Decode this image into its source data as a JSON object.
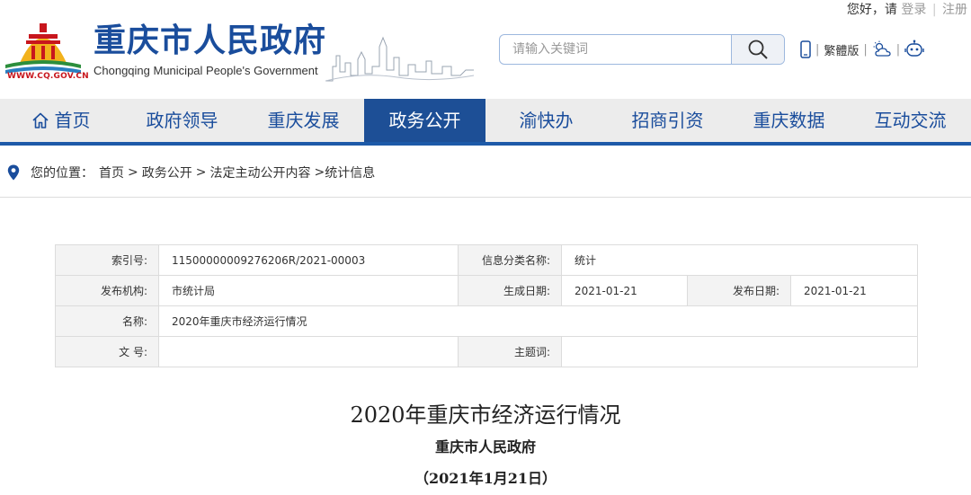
{
  "header": {
    "logo_url_text": "WWW.CQ.GOV.CN",
    "site_title": "重庆市人民政府",
    "site_subtitle": "Chongqing Municipal People's Government",
    "greeting": "您好，请",
    "login_label": "登录",
    "divider": "|",
    "register_label": "注册",
    "search_placeholder": "请输入关键词",
    "traditional_label": "繁體版",
    "icons": [
      "mobile-icon",
      "weather-icon",
      "robot-icon",
      "search-icon"
    ]
  },
  "nav": {
    "items": [
      {
        "label": "首页",
        "icon": "home-icon"
      },
      {
        "label": "政府领导"
      },
      {
        "label": "重庆发展"
      },
      {
        "label": "政务公开",
        "active": true
      },
      {
        "label": "渝快办"
      },
      {
        "label": "招商引资"
      },
      {
        "label": "重庆数据"
      },
      {
        "label": "互动交流"
      }
    ]
  },
  "breadcrumb": {
    "prefix": "您的位置：",
    "items": [
      "首页",
      "政务公开",
      "法定主动公开内容",
      "统计信息"
    ],
    "separator": ">"
  },
  "info": {
    "index_label": "索引号:",
    "index_value": "11500000009276206R/2021-00003",
    "category_label": "信息分类名称:",
    "category_value": "统计",
    "publisher_label": "发布机构:",
    "publisher_value": "市统计局",
    "created_label": "生成日期:",
    "created_value": "2021-01-21",
    "published_label": "发布日期:",
    "published_value": "2021-01-21",
    "name_label": "名称:",
    "name_value": "2020年重庆市经济运行情况",
    "docno_label": "文 号:",
    "docno_value": "",
    "subject_label": "主题词:",
    "subject_value": ""
  },
  "article": {
    "title": "2020年重庆市经济运行情况",
    "org": "重庆市人民政府",
    "date": "（2021年1月21日）"
  },
  "colors": {
    "brand_blue": "#1a4d9c",
    "nav_active": "#1d4f96",
    "logo_red": "#c8161d",
    "logo_yellow": "#f2b21c"
  }
}
